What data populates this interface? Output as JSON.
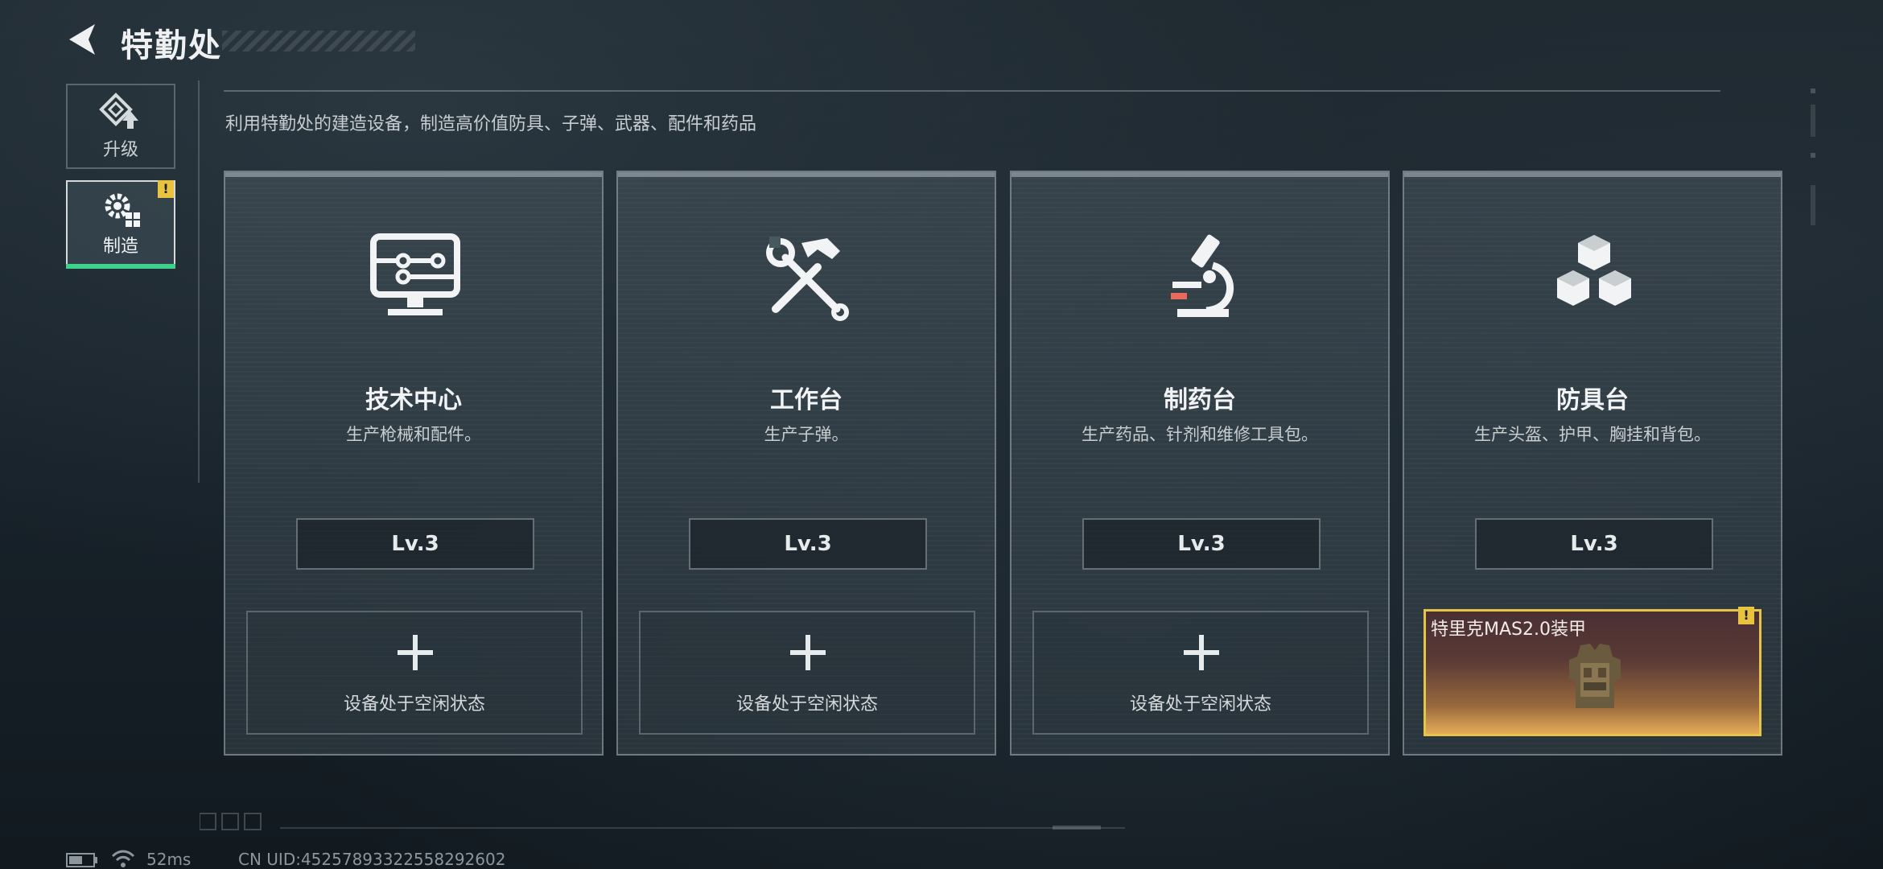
{
  "header": {
    "back_icon": "back-arrow-icon",
    "title": "特勤处"
  },
  "side_tabs": [
    {
      "label": "升级",
      "icon": "upgrade-icon",
      "active": false
    },
    {
      "label": "制造",
      "icon": "gears-icon",
      "active": true,
      "badge": "!"
    }
  ],
  "subtitle": "利用特勤处的建造设备，制造高价值防具、子弹、武器、配件和药品",
  "cards": [
    {
      "title": "技术中心",
      "desc": "生产枪械和配件。",
      "level": "Lv.3",
      "icon": "computer-monitor-icon",
      "slot_text": "设备处于空闲状态"
    },
    {
      "title": "工作台",
      "desc": "生产子弹。",
      "level": "Lv.3",
      "icon": "hammer-wrench-icon",
      "slot_text": "设备处于空闲状态"
    },
    {
      "title": "制药台",
      "desc": "生产药品、针剂和维修工具包。",
      "level": "Lv.3",
      "icon": "microscope-icon",
      "slot_text": "设备处于空闲状态"
    },
    {
      "title": "防具台",
      "desc": "生产头盔、护甲、胸挂和背包。",
      "level": "Lv.3",
      "icon": "cubes-icon",
      "slot_item": "特里克MAS2.0装甲",
      "slot_badge": "!"
    }
  ],
  "footer": {
    "ping": "52ms",
    "uid": "CN UID:452578933225582926​02"
  },
  "colors": {
    "accent_green": "#3ed18c",
    "alert_yellow": "#e8c340",
    "item_border_gold": "#e6c448"
  }
}
